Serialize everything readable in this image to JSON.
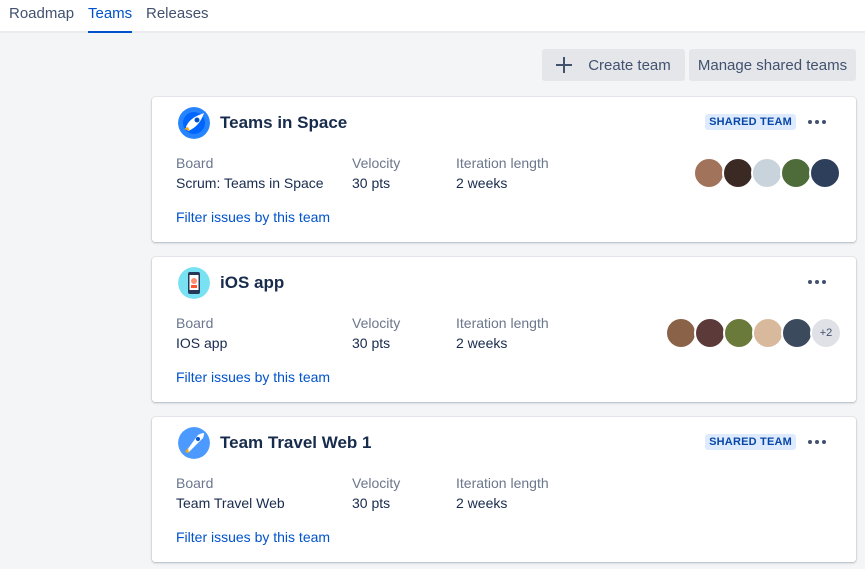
{
  "nav": {
    "tabs": [
      {
        "label": "Roadmap",
        "active": false
      },
      {
        "label": "Teams",
        "active": true
      },
      {
        "label": "Releases",
        "active": false
      }
    ]
  },
  "toolbar": {
    "create_label": "Create team",
    "manage_label": "Manage shared teams"
  },
  "labels": {
    "board": "Board",
    "velocity": "Velocity",
    "iteration": "Iteration length",
    "filter": "Filter issues by this team"
  },
  "teams": [
    {
      "name": "Teams in Space",
      "icon": "rocket-planet-icon",
      "badge": "SHARED TEAM",
      "board": "Scrum: Teams in Space",
      "velocity": "30 pts",
      "iteration": "2 weeks",
      "avatar_count": 5,
      "extra_members": ""
    },
    {
      "name": "iOS app",
      "icon": "mobile-phone-icon",
      "badge": "",
      "board": "IOS app",
      "velocity": "30 pts",
      "iteration": "2 weeks",
      "avatar_count": 5,
      "extra_members": "+2"
    },
    {
      "name": "Team Travel Web 1",
      "icon": "rocket-launch-icon",
      "badge": "SHARED TEAM",
      "board": "Team Travel Web",
      "velocity": "30 pts",
      "iteration": "2 weeks",
      "avatar_count": 0,
      "extra_members": ""
    }
  ],
  "colors": {
    "accent": "#0052cc",
    "badge_bg": "#deebff",
    "badge_text": "#0747a6",
    "background": "#f4f5f7"
  }
}
